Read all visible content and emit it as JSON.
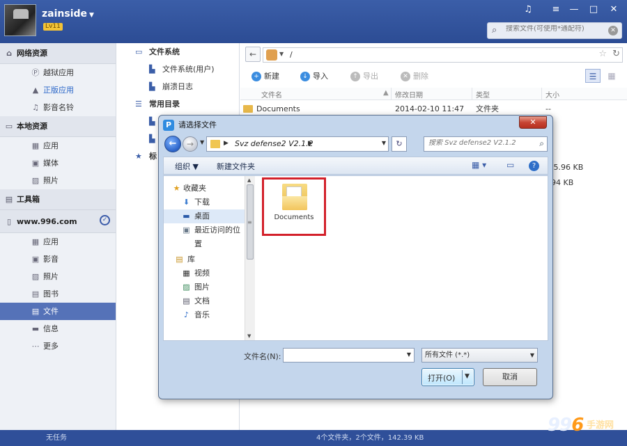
{
  "header": {
    "username": "zainside",
    "level": "Lv11",
    "search_placeholder": "搜索文件(可使用*通配符)",
    "icons": [
      "music-icon",
      "menu-icon",
      "minimize-icon",
      "close-icon"
    ]
  },
  "sidebar": {
    "sections": [
      {
        "title": "网络资源",
        "icon": "home-icon",
        "items": [
          {
            "label": "越狱应用",
            "icon": "p-icon"
          },
          {
            "label": "正版应用",
            "icon": "store-icon",
            "highlight": true
          },
          {
            "label": "影音名铃",
            "icon": "music-icon"
          }
        ]
      },
      {
        "title": "本地资源",
        "icon": "monitor-icon",
        "items": [
          {
            "label": "应用",
            "icon": "grid-icon"
          },
          {
            "label": "媒体",
            "icon": "video-icon"
          },
          {
            "label": "照片",
            "icon": "photo-icon"
          }
        ]
      },
      {
        "title": "工具箱",
        "icon": "toolbox-icon",
        "items": []
      },
      {
        "title": "www.996.com",
        "icon": "phone-icon",
        "items": [
          {
            "label": "应用",
            "icon": "grid-icon"
          },
          {
            "label": "影音",
            "icon": "video-icon"
          },
          {
            "label": "照片",
            "icon": "photo-icon"
          },
          {
            "label": "图书",
            "icon": "book-icon"
          },
          {
            "label": "文件",
            "icon": "file-icon",
            "active": true
          },
          {
            "label": "信息",
            "icon": "message-icon"
          },
          {
            "label": "更多",
            "icon": "more-icon"
          }
        ]
      }
    ]
  },
  "tree": {
    "fs_title": "文件系统",
    "fs_items": [
      "文件系统(用户)",
      "崩溃日志"
    ],
    "common_title": "常用目录",
    "bookmark_title": "标"
  },
  "main": {
    "path": "/",
    "toolbar": {
      "new": "新建",
      "import": "导入",
      "export": "导出",
      "delete": "删除"
    },
    "columns": {
      "name": "文件名",
      "date": "修改日期",
      "type": "类型",
      "size": "大小"
    },
    "rows": [
      {
        "name": "Documents",
        "date": "2014-02-10 11:47",
        "type": "文件夹",
        "size": "--"
      },
      {
        "name": "",
        "date": "",
        "type": "",
        "size": ""
      },
      {
        "name": "",
        "date": "",
        "type": "",
        "size": ""
      },
      {
        "name": "",
        "date": "",
        "type": "",
        "size": ".5.96 KB"
      },
      {
        "name": "",
        "date": "",
        "type": "",
        "size": "94 KB"
      }
    ]
  },
  "status": {
    "left": "无任务",
    "middle": "4个文件夹，2个文件，142.39 KB"
  },
  "watermark": {
    "num1": "99",
    "num2": "6",
    "text": "手游网"
  },
  "dialog": {
    "title": "请选择文件",
    "address": "Svz defense2 V2.1.2",
    "search_placeholder": "搜索 Svz defense2 V2.1.2",
    "organize": "组织 ▼",
    "new_folder": "新建文件夹",
    "nav": {
      "favorites": "收藏夹",
      "downloads": "下载",
      "desktop": "桌面",
      "recent": "最近访问的位置",
      "library": "库",
      "videos": "视频",
      "pictures": "图片",
      "documents": "文档",
      "music": "音乐"
    },
    "folder_name": "Documents",
    "filename_label": "文件名(N):",
    "filename_value": "",
    "filetype": "所有文件 (*.*)",
    "open": "打开(O)",
    "cancel": "取消"
  }
}
